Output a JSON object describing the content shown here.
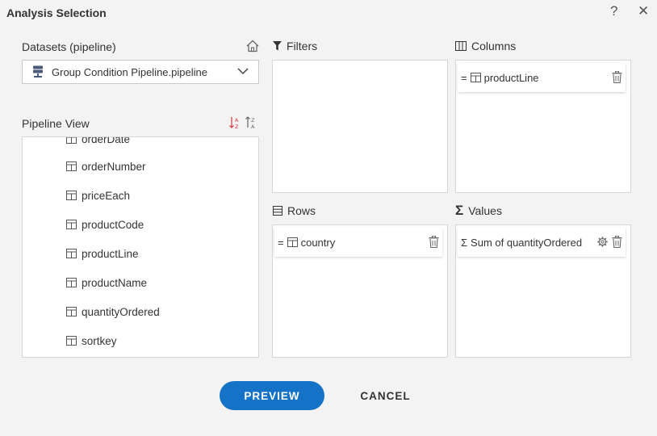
{
  "window": {
    "title": "Analysis Selection",
    "help": "?",
    "close": "✕"
  },
  "datasets": {
    "label": "Datasets (pipeline)",
    "selected": "Group Condition Pipeline.pipeline"
  },
  "pipeline_view": {
    "label": "Pipeline View",
    "fields": [
      "orderDate",
      "orderNumber",
      "priceEach",
      "productCode",
      "productLine",
      "productName",
      "quantityOrdered",
      "sortkey"
    ]
  },
  "filters": {
    "label": "Filters"
  },
  "columns": {
    "label": "Columns",
    "items": [
      {
        "prefix": "=",
        "name": "productLine"
      }
    ]
  },
  "rows": {
    "label": "Rows",
    "items": [
      {
        "prefix": "=",
        "name": "country"
      }
    ]
  },
  "values": {
    "label": "Values",
    "items": [
      {
        "prefix": "Σ",
        "name": "Sum of quantityOrdered"
      }
    ]
  },
  "buttons": {
    "preview": "PREVIEW",
    "cancel": "CANCEL"
  },
  "colors": {
    "accent": "#1473c6",
    "sort_accent": "#d9363e"
  }
}
